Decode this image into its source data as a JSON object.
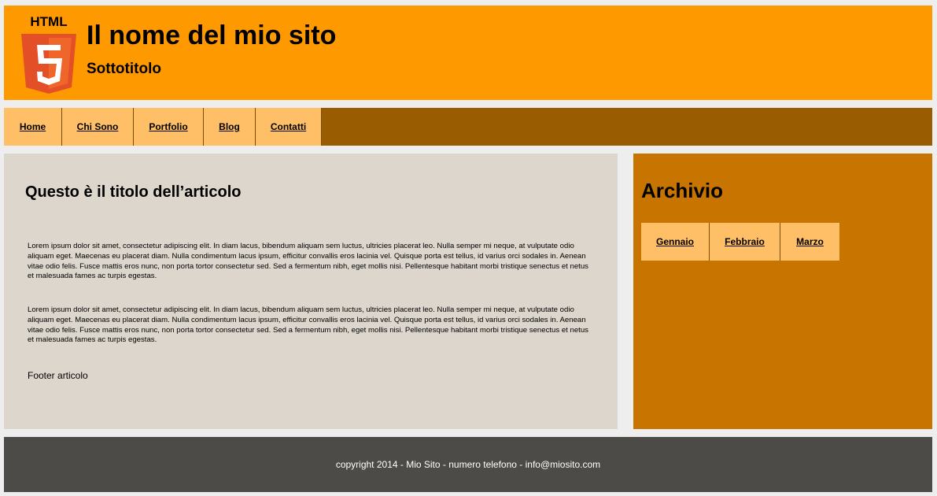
{
  "header": {
    "logo_text": "HTML",
    "title": "Il nome del mio sito",
    "subtitle": "Sottotitolo",
    "colors": {
      "background": "#ff9900"
    }
  },
  "nav": {
    "items": [
      {
        "label": "Home"
      },
      {
        "label": "Chi Sono"
      },
      {
        "label": "Portfolio"
      },
      {
        "label": "Blog"
      },
      {
        "label": "Contatti"
      }
    ],
    "colors": {
      "bar": "#995c00",
      "item": "#ffbf66"
    }
  },
  "article": {
    "title": "Questo è il titolo dell’articolo",
    "paragraphs": [
      "Lorem ipsum dolor sit amet, consectetur adipiscing elit. In diam lacus, bibendum aliquam sem luctus, ultricies placerat leo. Nulla semper mi neque, at vulputate odio aliquam eget. Maecenas eu placerat diam. Nulla condimentum lacus ipsum, efficitur convallis eros lacinia vel. Quisque porta est tellus, id varius orci sodales in. Aenean vitae odio felis. Fusce mattis eros nunc, non porta tortor consectetur sed. Sed a fermentum nibh, eget mollis nisi. Pellentesque habitant morbi tristique senectus et netus et malesuada fames ac turpis egestas.",
      "Lorem ipsum dolor sit amet, consectetur adipiscing elit. In diam lacus, bibendum aliquam sem luctus, ultricies placerat leo. Nulla semper mi neque, at vulputate odio aliquam eget. Maecenas eu placerat diam. Nulla condimentum lacus ipsum, efficitur convallis eros lacinia vel. Quisque porta est tellus, id varius orci sodales in. Aenean vitae odio felis. Fusce mattis eros nunc, non porta tortor consectetur sed. Sed a fermentum nibh, eget mollis nisi. Pellentesque habitant morbi tristique senectus et netus et malesuada fames ac turpis egestas."
    ],
    "footer": "Footer articolo",
    "colors": {
      "background": "#ddd6cc"
    }
  },
  "aside": {
    "title": "Archivio",
    "items": [
      {
        "label": "Gennaio"
      },
      {
        "label": "Febbraio"
      },
      {
        "label": "Marzo"
      }
    ],
    "colors": {
      "background": "#c77400"
    }
  },
  "footer": {
    "text": "copyright 2014 - Mio Sito - numero telefono - info@miosito.com",
    "colors": {
      "background": "#4d4b48"
    }
  }
}
